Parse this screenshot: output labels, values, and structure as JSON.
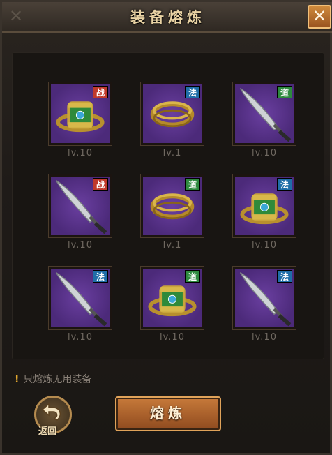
{
  "window": {
    "title": "装备熔炼",
    "close_label": "✕"
  },
  "items": [
    {
      "type": "ring",
      "badge": "战",
      "badge_color": "#c0392b",
      "level": "lv.10"
    },
    {
      "type": "plain-ring",
      "badge": "法",
      "badge_color": "#1f6ea8",
      "level": "lv.1"
    },
    {
      "type": "sword",
      "badge": "道",
      "badge_color": "#2d8a3e",
      "level": "lv.10"
    },
    {
      "type": "sword",
      "badge": "战",
      "badge_color": "#c0392b",
      "level": "lv.10"
    },
    {
      "type": "plain-ring",
      "badge": "道",
      "badge_color": "#2d8a3e",
      "level": "lv.1"
    },
    {
      "type": "ring",
      "badge": "法",
      "badge_color": "#1f6ea8",
      "level": "lv.10"
    },
    {
      "type": "sword",
      "badge": "法",
      "badge_color": "#1f6ea8",
      "level": "lv.10"
    },
    {
      "type": "ring",
      "badge": "道",
      "badge_color": "#2d8a3e",
      "level": "lv.10"
    },
    {
      "type": "sword",
      "badge": "法",
      "badge_color": "#1f6ea8",
      "level": "lv.10"
    }
  ],
  "hint": {
    "mark": "!",
    "text": "只熔炼无用装备"
  },
  "buttons": {
    "back_label": "返回",
    "smelt_label": "熔炼"
  }
}
